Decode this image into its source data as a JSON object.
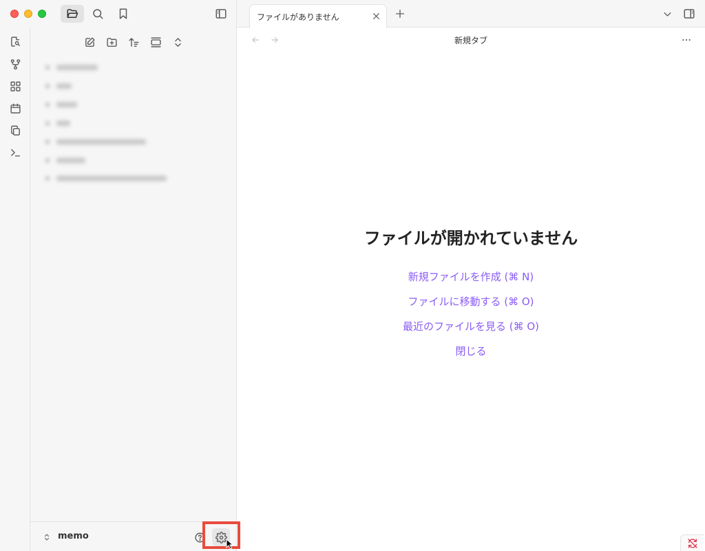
{
  "tab": {
    "title": "ファイルがありません"
  },
  "view": {
    "title": "新規タブ"
  },
  "empty_state": {
    "title": "ファイルが開かれていません",
    "actions": [
      "新規ファイルを作成 (⌘ N)",
      "ファイルに移動する (⌘ O)",
      "最近のファイルを見る (⌘ O)",
      "閉じる"
    ]
  },
  "vault": {
    "name": "memo"
  },
  "file_tree": {
    "items": [
      "",
      "",
      "",
      "",
      "",
      "",
      ""
    ]
  },
  "colors": {
    "accent": "#8a5cf5",
    "highlight": "#e94b3c"
  }
}
